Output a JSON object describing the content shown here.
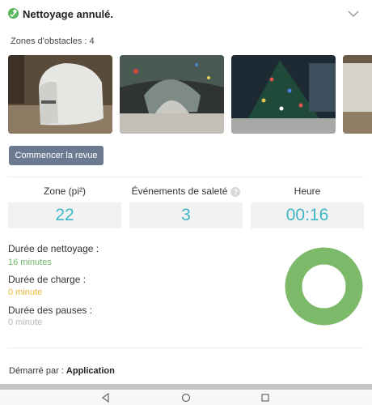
{
  "header": {
    "title": "Nettoyage annulé.",
    "status_color": "#5cb85c"
  },
  "obstacles": {
    "label": "Zones d'obstacles : 4",
    "images": [
      "obstacle-photo-1",
      "obstacle-photo-2",
      "obstacle-photo-3",
      "obstacle-photo-4"
    ]
  },
  "review_button": {
    "label": "Commencer la revue"
  },
  "stats": {
    "zone": {
      "label": "Zone (pi²)",
      "value": "22"
    },
    "dirt": {
      "label": "Événements de saleté",
      "value": "3"
    },
    "time": {
      "label": "Heure",
      "value": "00:16"
    },
    "value_color": "#3fb6c6"
  },
  "durations": {
    "cleaning": {
      "label": "Durée de nettoyage :",
      "value": "16 minutes",
      "color": "#6fb86a"
    },
    "charging": {
      "label": "Durée de charge :",
      "value": "0 minute",
      "color": "#e9b93a"
    },
    "pauses": {
      "label": "Durée des pauses :",
      "value": "0 minute",
      "color": "#b8b8b8"
    }
  },
  "chart_data": {
    "type": "pie",
    "categories": [
      "Durée de nettoyage",
      "Durée de charge",
      "Durée des pauses"
    ],
    "values": [
      16,
      0,
      0
    ],
    "colors": [
      "#7cba6a",
      "#e9b93a",
      "#b8b8b8"
    ]
  },
  "footer": {
    "started_by_label": "Démarré par :",
    "started_by_value": "Application"
  },
  "navbar": {
    "icons": [
      "back-icon",
      "home-icon",
      "recents-icon"
    ]
  }
}
